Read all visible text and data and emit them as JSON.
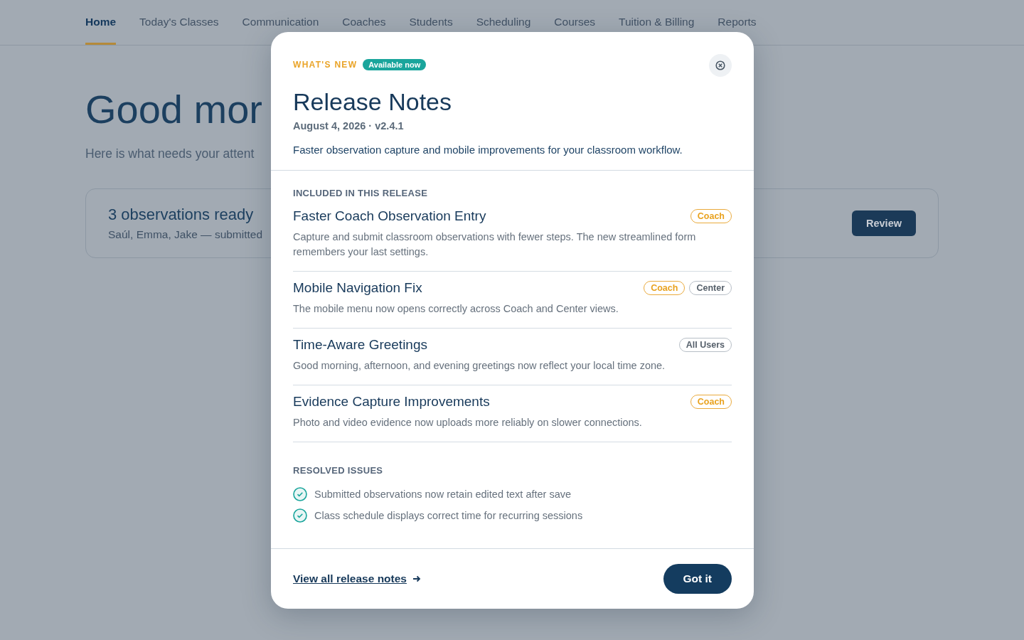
{
  "nav": {
    "tabs": [
      {
        "label": "Home",
        "selected": true
      },
      {
        "label": "Today's Classes",
        "selected": false
      },
      {
        "label": "Communication",
        "selected": false
      },
      {
        "label": "Coaches",
        "selected": false
      },
      {
        "label": "Students",
        "selected": false
      },
      {
        "label": "Scheduling",
        "selected": false
      },
      {
        "label": "Courses",
        "selected": false
      },
      {
        "label": "Tuition & Billing",
        "selected": false
      },
      {
        "label": "Reports",
        "selected": false
      }
    ]
  },
  "page": {
    "greeting": "Good mor",
    "subtitle": "Here is what needs your attent",
    "card": {
      "title": "3 observations ready",
      "meta": "Saúl, Emma, Jake — submitted",
      "button": "Review"
    }
  },
  "modal": {
    "eyebrow": "WHAT'S NEW",
    "badge": "Available now",
    "title": "Release Notes",
    "date": "August 4, 2026 · v2.4.1",
    "summary": "Faster observation capture and mobile improvements for your classroom workflow.",
    "included_heading": "INCLUDED IN THIS RELEASE",
    "items": [
      {
        "title": "Faster Coach Observation Entry",
        "tags": [
          {
            "label": "Coach",
            "kind": "role"
          }
        ],
        "text": "Capture and submit classroom observations with fewer steps. The new streamlined form remembers your last settings."
      },
      {
        "title": "Mobile Navigation Fix",
        "tags": [
          {
            "label": "Coach",
            "kind": "role"
          },
          {
            "label": "Center",
            "kind": "scope"
          }
        ],
        "text": "The mobile menu now opens correctly across Coach and Center views."
      },
      {
        "title": "Time-Aware Greetings",
        "tags": [
          {
            "label": "All Users",
            "kind": "scope"
          }
        ],
        "text": "Good morning, afternoon, and evening greetings now reflect your local time zone."
      },
      {
        "title": "Evidence Capture Improvements",
        "tags": [
          {
            "label": "Coach",
            "kind": "role"
          }
        ],
        "text": "Photo and video evidence now uploads more reliably on slower connections."
      }
    ],
    "resolved_heading": "RESOLVED ISSUES",
    "resolved": [
      "Submitted observations now retain edited text after save",
      "Class schedule displays correct time for recurring sessions"
    ],
    "link": "View all release notes",
    "button": "Got it"
  }
}
